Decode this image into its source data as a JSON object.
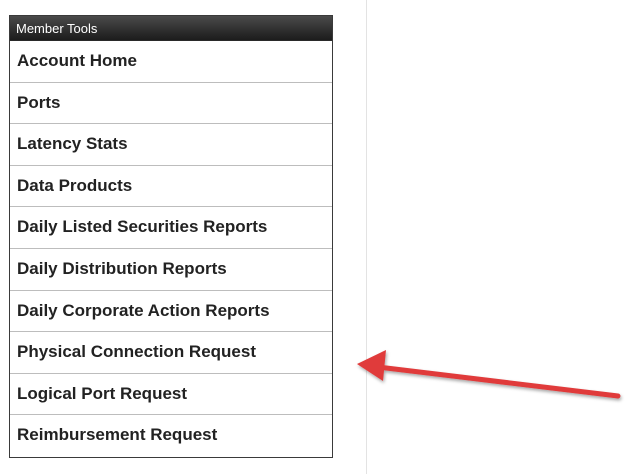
{
  "panel": {
    "title": "Member Tools",
    "items": [
      {
        "label": "Account Home"
      },
      {
        "label": "Ports"
      },
      {
        "label": "Latency Stats"
      },
      {
        "label": "Data Products"
      },
      {
        "label": "Daily Listed Securities Reports"
      },
      {
        "label": "Daily Distribution Reports"
      },
      {
        "label": "Daily Corporate Action Reports"
      },
      {
        "label": "Physical Connection Request"
      },
      {
        "label": "Logical Port Request"
      },
      {
        "label": "Reimbursement Request"
      }
    ]
  },
  "annotation": {
    "arrow_color": "#e03a3a",
    "icon": "annotation-arrow-icon"
  }
}
